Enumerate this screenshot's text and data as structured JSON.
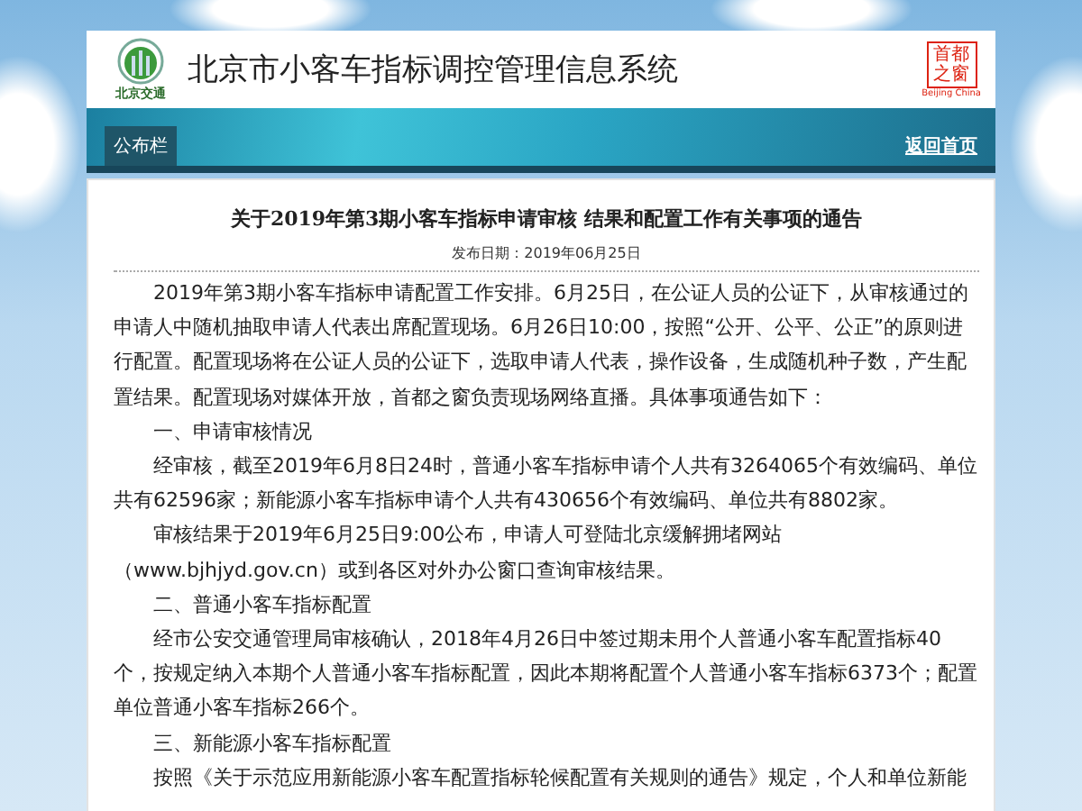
{
  "header": {
    "logo_caption": "北京交通",
    "site_title": "北京市小客车指标调控管理信息系统",
    "seal_text": "首都之窗",
    "seal_caption": "Beijing China"
  },
  "banner": {
    "tab": "公布栏",
    "home_link": "返回首页"
  },
  "article": {
    "title": "关于2019年第3期小客车指标申请审核 结果和配置工作有关事项的通告",
    "date": "发布日期：2019年06月25日",
    "paragraphs": [
      "2019年第3期小客车指标申请配置工作安排。6月25日，在公证人员的公证下，从审核通过的申请人中随机抽取申请人代表出席配置现场。6月26日10:00，按照“公开、公平、公正”的原则进行配置。配置现场将在公证人员的公证下，选取申请人代表，操作设备，生成随机种子数，产生配置结果。配置现场对媒体开放，首都之窗负责现场网络直播。具体事项通告如下：",
      "一、申请审核情况",
      "经审核，截至2019年6月8日24时，普通小客车指标申请个人共有3264065个有效编码、单位共有62596家；新能源小客车指标申请个人共有430656个有效编码、单位共有8802家。",
      "审核结果于2019年6月25日9:00公布，申请人可登陆北京缓解拥堵网站（www.bjhjyd.gov.cn）或到各区对外办公窗口查询审核结果。",
      "二、普通小客车指标配置",
      "经市公安交通管理局审核确认，2018年4月26日中签过期未用个人普通小客车配置指标40个，按规定纳入本期个人普通小客车指标配置，因此本期将配置个人普通小客车指标6373个；配置单位普通小客车指标266个。",
      "三、新能源小客车指标配置",
      "按照《关于示范应用新能源小客车配置指标轮候配置有关规则的通告》规定，个人和单位新能"
    ]
  }
}
